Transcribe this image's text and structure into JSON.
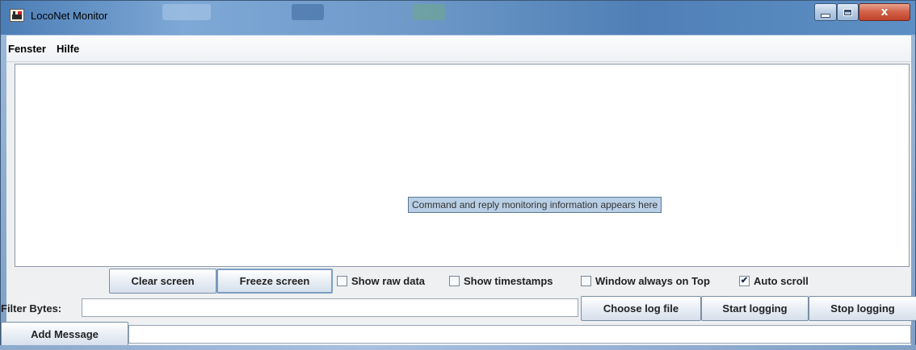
{
  "window": {
    "title": "LocoNet Monitor",
    "close_glyph": "x"
  },
  "menu": {
    "items": [
      "Fenster",
      "Hilfe"
    ]
  },
  "monitor": {
    "tooltip": "Command and reply monitoring information appears here"
  },
  "controls": {
    "clear_label": "Clear screen",
    "freeze_label": "Freeze screen",
    "checkboxes": [
      {
        "label": "Show raw data",
        "checked": false
      },
      {
        "label": "Show timestamps",
        "checked": false
      },
      {
        "label": "Window always on Top",
        "checked": false
      },
      {
        "label": "Auto scroll",
        "checked": true
      }
    ]
  },
  "filter": {
    "label": "Filter Bytes:",
    "value": ""
  },
  "logging": {
    "choose_label": "Choose log file",
    "start_label": "Start logging",
    "stop_label": "Stop logging"
  },
  "message": {
    "add_label": "Add Message",
    "value": ""
  },
  "colors": {
    "accent": "#4b7db5",
    "close_button": "#c0412a",
    "tooltip_bg": "#b8cfe5"
  },
  "icons": {
    "app": "locomotive-icon",
    "minimize": "minimize-icon",
    "maximize": "maximize-icon",
    "close": "close-icon",
    "check": "checkmark-icon"
  }
}
